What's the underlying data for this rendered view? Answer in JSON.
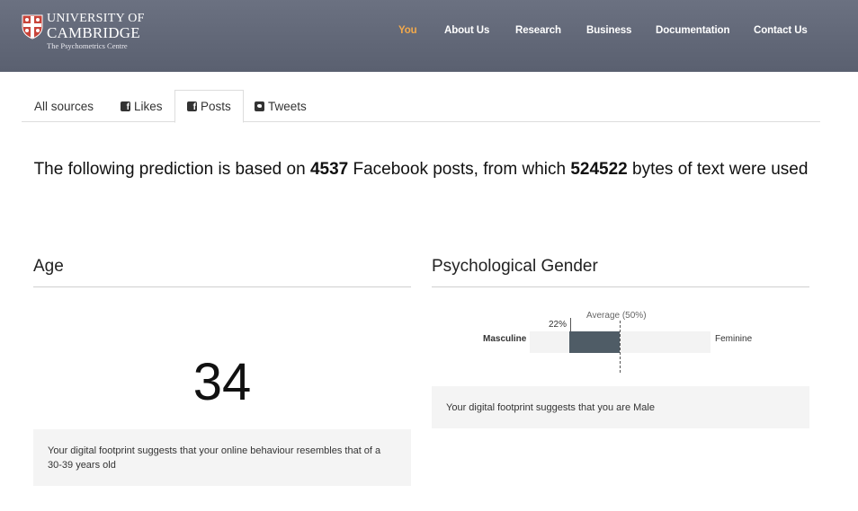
{
  "header": {
    "logo": {
      "line1": "UNIVERSITY OF",
      "line2": "CAMBRIDGE",
      "line3": "The Psychometrics Centre"
    },
    "nav": [
      {
        "label": "You",
        "active": true
      },
      {
        "label": "About Us",
        "active": false
      },
      {
        "label": "Research",
        "active": false
      },
      {
        "label": "Business",
        "active": false
      },
      {
        "label": "Documentation",
        "active": false
      },
      {
        "label": "Contact Us",
        "active": false
      }
    ],
    "accent_color": "#f2a94c"
  },
  "tabs": [
    {
      "label": "All sources",
      "icon": null,
      "active": false
    },
    {
      "label": "Likes",
      "icon": "facebook-icon",
      "active": false
    },
    {
      "label": "Posts",
      "icon": "facebook-icon",
      "active": true
    },
    {
      "label": "Tweets",
      "icon": "twitter-icon",
      "active": false
    }
  ],
  "summary": {
    "prefix": "The following prediction is based on",
    "posts_count": "4537",
    "middle": "Facebook posts, from which",
    "bytes_count": "524522",
    "suffix": "bytes of text were used"
  },
  "age": {
    "title": "Age",
    "value": "34",
    "note": "Your digital footprint suggests that your online behaviour resembles that of a 30-39 years old"
  },
  "gender": {
    "title": "Psychological Gender",
    "left_label": "Masculine",
    "right_label": "Feminine",
    "value_label": "22%",
    "value": 22,
    "average_label": "Average (50%)",
    "average": 50,
    "bar_color": "#4f5c66",
    "note": "Your digital footprint suggests that you are Male"
  }
}
